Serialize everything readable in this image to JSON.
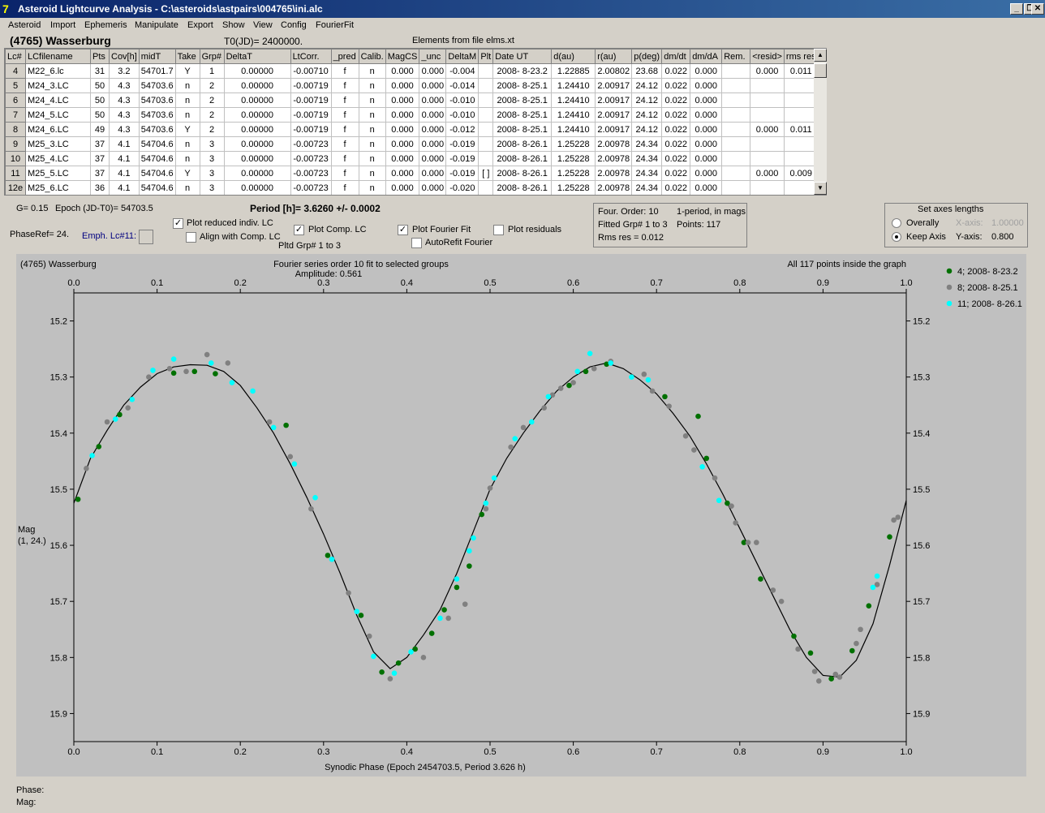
{
  "window": {
    "title": "Asteroid Lightcurve Analysis - C:\\asteroids\\astpairs\\004765\\ini.alc",
    "icon": "7",
    "btn_min": "_",
    "btn_restore": "❐",
    "btn_close": "✕"
  },
  "menu": [
    "Asteroid",
    "Import",
    "Ephemeris",
    "Manipulate",
    "Export",
    "Show",
    "View",
    "Config",
    "FourierFit"
  ],
  "header": {
    "asteroid": "(4765) Wasserburg",
    "t0": "T0(JD)= 2400000.",
    "elements": "Elements from file elms.xt"
  },
  "table": {
    "columns": [
      "Lc#",
      "LCfilename",
      "Pts",
      "Cov[h]",
      "midT",
      "Take",
      "Grp#",
      "DeltaT",
      "LtCorr.",
      "_pred",
      "Calib.",
      "MagCS",
      "_unc",
      "DeltaM",
      "Plt",
      "Date UT",
      "d(au)",
      "r(au)",
      "p(deg)",
      "dm/dt",
      "dm/dA",
      "Rem.",
      "<resid>",
      "rms res"
    ],
    "rows": [
      [
        "4",
        "M22_6.lc",
        "31",
        "3.2",
        "54701.7",
        "Y",
        "1",
        "0.00000",
        "-0.00710",
        "f",
        "n",
        "0.000",
        "0.000",
        "-0.004",
        "",
        "2008- 8-23.2",
        "1.22885",
        "2.00802",
        "23.68",
        "0.022",
        "0.000",
        "",
        "0.000",
        "0.011"
      ],
      [
        "5",
        "M24_3.LC",
        "50",
        "4.3",
        "54703.6",
        "n",
        "2",
        "0.00000",
        "-0.00719",
        "f",
        "n",
        "0.000",
        "0.000",
        "-0.014",
        "",
        "2008- 8-25.1",
        "1.24410",
        "2.00917",
        "24.12",
        "0.022",
        "0.000",
        "",
        "",
        ""
      ],
      [
        "6",
        "M24_4.LC",
        "50",
        "4.3",
        "54703.6",
        "n",
        "2",
        "0.00000",
        "-0.00719",
        "f",
        "n",
        "0.000",
        "0.000",
        "-0.010",
        "",
        "2008- 8-25.1",
        "1.24410",
        "2.00917",
        "24.12",
        "0.022",
        "0.000",
        "",
        "",
        ""
      ],
      [
        "7",
        "M24_5.LC",
        "50",
        "4.3",
        "54703.6",
        "n",
        "2",
        "0.00000",
        "-0.00719",
        "f",
        "n",
        "0.000",
        "0.000",
        "-0.010",
        "",
        "2008- 8-25.1",
        "1.24410",
        "2.00917",
        "24.12",
        "0.022",
        "0.000",
        "",
        "",
        ""
      ],
      [
        "8",
        "M24_6.LC",
        "49",
        "4.3",
        "54703.6",
        "Y",
        "2",
        "0.00000",
        "-0.00719",
        "f",
        "n",
        "0.000",
        "0.000",
        "-0.012",
        "",
        "2008- 8-25.1",
        "1.24410",
        "2.00917",
        "24.12",
        "0.022",
        "0.000",
        "",
        "0.000",
        "0.011"
      ],
      [
        "9",
        "M25_3.LC",
        "37",
        "4.1",
        "54704.6",
        "n",
        "3",
        "0.00000",
        "-0.00723",
        "f",
        "n",
        "0.000",
        "0.000",
        "-0.019",
        "",
        "2008- 8-26.1",
        "1.25228",
        "2.00978",
        "24.34",
        "0.022",
        "0.000",
        "",
        "",
        ""
      ],
      [
        "10",
        "M25_4.LC",
        "37",
        "4.1",
        "54704.6",
        "n",
        "3",
        "0.00000",
        "-0.00723",
        "f",
        "n",
        "0.000",
        "0.000",
        "-0.019",
        "",
        "2008- 8-26.1",
        "1.25228",
        "2.00978",
        "24.34",
        "0.022",
        "0.000",
        "",
        "",
        ""
      ],
      [
        "11",
        "M25_5.LC",
        "37",
        "4.1",
        "54704.6",
        "Y",
        "3",
        "0.00000",
        "-0.00723",
        "f",
        "n",
        "0.000",
        "0.000",
        "-0.019",
        "[ ]",
        "2008- 8-26.1",
        "1.25228",
        "2.00978",
        "24.34",
        "0.022",
        "0.000",
        "",
        "0.000",
        "0.009"
      ],
      [
        "12e",
        "M25_6.LC",
        "36",
        "4.1",
        "54704.6",
        "n",
        "3",
        "0.00000",
        "-0.00723",
        "f",
        "n",
        "0.000",
        "0.000",
        "-0.020",
        "",
        "2008- 8-26.1",
        "1.25228",
        "2.00978",
        "24.34",
        "0.022",
        "0.000",
        "",
        "",
        ""
      ]
    ],
    "scroll_up": "▲",
    "scroll_down": "▼"
  },
  "controls": {
    "g": "G= 0.15",
    "epoch": "Epoch (JD-T0)= 54703.5",
    "period": "Period [h]= 3.6260 +/- 0.0002",
    "phaseref": "PhaseRef= 24.",
    "emph": "Emph. Lc#11:",
    "plot_reduced": "Plot reduced indiv. LC",
    "align_comp": "Align with Comp. LC",
    "plot_comp": "Plot Comp. LC",
    "pltd_grp": "Pltd Grp#  1   to   3",
    "plot_fourier": "Plot Fourier Fit",
    "autorefit": "AutoRefit Fourier",
    "plot_residuals": "Plot residuals",
    "check_mark": "✓",
    "info": {
      "order": "Four. Order: 10",
      "mode": "1-period, in mags",
      "fitted": "Fitted Grp# 1 to 3",
      "points": "Points: 117",
      "rms": "Rms res      = 0.012"
    },
    "axes": {
      "title": "Set axes lengths",
      "overally": "Overally",
      "keep": "Keep Axis",
      "xaxis": "X-axis:",
      "xval": "1.00000",
      "yaxis": "Y-axis:",
      "yval": "0.800"
    }
  },
  "plot": {
    "asteroid": "(4765) Wasserburg",
    "fourier_title": "Fourier series order 10 fit to selected groups",
    "amplitude": "Amplitude: 0.561",
    "points_info": "All 117 points inside the graph",
    "xlabel": "Synodic Phase (Epoch 2454703.5, Period 3.626 h)",
    "ylabel_1": "Mag",
    "ylabel_2": "(1, 24.)",
    "phase_label": "Phase:",
    "mag_label": "Mag:"
  },
  "chart_data": {
    "type": "scatter",
    "xlim": [
      0.0,
      1.0
    ],
    "ylim": [
      15.95,
      15.15
    ],
    "grid": false,
    "legend_position": "top-right",
    "x_ticks": [
      "0.0",
      "0.1",
      "0.2",
      "0.3",
      "0.4",
      "0.5",
      "0.6",
      "0.7",
      "0.8",
      "0.9",
      "1.0"
    ],
    "y_ticks": [
      "15.2",
      "15.3",
      "15.4",
      "15.5",
      "15.6",
      "15.7",
      "15.8",
      "15.9"
    ],
    "series": [
      {
        "name": "4; 2008- 8-23.2",
        "color": "#007000",
        "points": [
          [
            0.005,
            15.518
          ],
          [
            0.03,
            15.424
          ],
          [
            0.055,
            15.367
          ],
          [
            0.12,
            15.293
          ],
          [
            0.145,
            15.29
          ],
          [
            0.17,
            15.294
          ],
          [
            0.255,
            15.386
          ],
          [
            0.305,
            15.618
          ],
          [
            0.345,
            15.725
          ],
          [
            0.37,
            15.826
          ],
          [
            0.39,
            15.81
          ],
          [
            0.41,
            15.785
          ],
          [
            0.43,
            15.757
          ],
          [
            0.445,
            15.715
          ],
          [
            0.46,
            15.675
          ],
          [
            0.475,
            15.637
          ],
          [
            0.49,
            15.545
          ],
          [
            0.595,
            15.315
          ],
          [
            0.615,
            15.29
          ],
          [
            0.64,
            15.277
          ],
          [
            0.71,
            15.335
          ],
          [
            0.75,
            15.37
          ],
          [
            0.76,
            15.445
          ],
          [
            0.785,
            15.525
          ],
          [
            0.805,
            15.595
          ],
          [
            0.825,
            15.66
          ],
          [
            0.865,
            15.762
          ],
          [
            0.885,
            15.792
          ],
          [
            0.91,
            15.838
          ],
          [
            0.935,
            15.788
          ],
          [
            0.955,
            15.708
          ],
          [
            0.98,
            15.585
          ]
        ]
      },
      {
        "name": "8; 2008- 8-25.1",
        "color": "#808080",
        "points": [
          [
            0.015,
            15.463
          ],
          [
            0.04,
            15.38
          ],
          [
            0.065,
            15.355
          ],
          [
            0.09,
            15.3
          ],
          [
            0.115,
            15.285
          ],
          [
            0.135,
            15.29
          ],
          [
            0.16,
            15.26
          ],
          [
            0.185,
            15.275
          ],
          [
            0.235,
            15.38
          ],
          [
            0.26,
            15.442
          ],
          [
            0.285,
            15.535
          ],
          [
            0.31,
            15.625
          ],
          [
            0.33,
            15.685
          ],
          [
            0.355,
            15.762
          ],
          [
            0.38,
            15.838
          ],
          [
            0.42,
            15.8
          ],
          [
            0.45,
            15.73
          ],
          [
            0.47,
            15.705
          ],
          [
            0.495,
            15.535
          ],
          [
            0.5,
            15.498
          ],
          [
            0.525,
            15.425
          ],
          [
            0.54,
            15.39
          ],
          [
            0.565,
            15.355
          ],
          [
            0.575,
            15.332
          ],
          [
            0.585,
            15.32
          ],
          [
            0.6,
            15.31
          ],
          [
            0.625,
            15.285
          ],
          [
            0.645,
            15.272
          ],
          [
            0.685,
            15.295
          ],
          [
            0.695,
            15.325
          ],
          [
            0.715,
            15.352
          ],
          [
            0.735,
            15.405
          ],
          [
            0.745,
            15.43
          ],
          [
            0.77,
            15.48
          ],
          [
            0.79,
            15.53
          ],
          [
            0.795,
            15.56
          ],
          [
            0.81,
            15.595
          ],
          [
            0.82,
            15.595
          ],
          [
            0.84,
            15.68
          ],
          [
            0.85,
            15.7
          ],
          [
            0.87,
            15.785
          ],
          [
            0.89,
            15.825
          ],
          [
            0.895,
            15.842
          ],
          [
            0.915,
            15.83
          ],
          [
            0.92,
            15.835
          ],
          [
            0.94,
            15.775
          ],
          [
            0.945,
            15.75
          ],
          [
            0.965,
            15.67
          ],
          [
            0.985,
            15.555
          ],
          [
            0.99,
            15.55
          ]
        ]
      },
      {
        "name": "11; 2008- 8-26.1",
        "color": "#00ffff",
        "points": [
          [
            0.022,
            15.44
          ],
          [
            0.05,
            15.375
          ],
          [
            0.07,
            15.34
          ],
          [
            0.095,
            15.288
          ],
          [
            0.12,
            15.268
          ],
          [
            0.165,
            15.275
          ],
          [
            0.19,
            15.31
          ],
          [
            0.215,
            15.325
          ],
          [
            0.24,
            15.39
          ],
          [
            0.265,
            15.455
          ],
          [
            0.29,
            15.515
          ],
          [
            0.31,
            15.625
          ],
          [
            0.34,
            15.718
          ],
          [
            0.36,
            15.798
          ],
          [
            0.385,
            15.828
          ],
          [
            0.405,
            15.79
          ],
          [
            0.44,
            15.73
          ],
          [
            0.46,
            15.66
          ],
          [
            0.475,
            15.61
          ],
          [
            0.48,
            15.587
          ],
          [
            0.495,
            15.525
          ],
          [
            0.505,
            15.48
          ],
          [
            0.53,
            15.41
          ],
          [
            0.55,
            15.38
          ],
          [
            0.57,
            15.335
          ],
          [
            0.605,
            15.29
          ],
          [
            0.62,
            15.258
          ],
          [
            0.645,
            15.275
          ],
          [
            0.67,
            15.3
          ],
          [
            0.69,
            15.305
          ],
          [
            0.755,
            15.46
          ],
          [
            0.775,
            15.52
          ],
          [
            0.96,
            15.675
          ],
          [
            0.965,
            15.655
          ]
        ]
      }
    ],
    "fit_curve": [
      [
        0,
        15.525
      ],
      [
        0.02,
        15.445
      ],
      [
        0.04,
        15.395
      ],
      [
        0.06,
        15.35
      ],
      [
        0.08,
        15.318
      ],
      [
        0.1,
        15.294
      ],
      [
        0.12,
        15.282
      ],
      [
        0.14,
        15.278
      ],
      [
        0.16,
        15.279
      ],
      [
        0.18,
        15.29
      ],
      [
        0.2,
        15.315
      ],
      [
        0.22,
        15.355
      ],
      [
        0.24,
        15.4
      ],
      [
        0.26,
        15.455
      ],
      [
        0.28,
        15.515
      ],
      [
        0.3,
        15.58
      ],
      [
        0.32,
        15.65
      ],
      [
        0.34,
        15.725
      ],
      [
        0.36,
        15.79
      ],
      [
        0.38,
        15.82
      ],
      [
        0.4,
        15.8
      ],
      [
        0.42,
        15.76
      ],
      [
        0.44,
        15.715
      ],
      [
        0.46,
        15.65
      ],
      [
        0.48,
        15.575
      ],
      [
        0.5,
        15.5
      ],
      [
        0.52,
        15.445
      ],
      [
        0.54,
        15.4
      ],
      [
        0.56,
        15.36
      ],
      [
        0.58,
        15.325
      ],
      [
        0.6,
        15.3
      ],
      [
        0.62,
        15.282
      ],
      [
        0.64,
        15.275
      ],
      [
        0.66,
        15.285
      ],
      [
        0.68,
        15.305
      ],
      [
        0.7,
        15.33
      ],
      [
        0.72,
        15.365
      ],
      [
        0.74,
        15.405
      ],
      [
        0.76,
        15.455
      ],
      [
        0.78,
        15.51
      ],
      [
        0.8,
        15.57
      ],
      [
        0.82,
        15.63
      ],
      [
        0.84,
        15.69
      ],
      [
        0.86,
        15.75
      ],
      [
        0.88,
        15.8
      ],
      [
        0.9,
        15.832
      ],
      [
        0.92,
        15.835
      ],
      [
        0.94,
        15.805
      ],
      [
        0.96,
        15.74
      ],
      [
        0.98,
        15.635
      ],
      [
        1.0,
        15.52
      ]
    ]
  }
}
